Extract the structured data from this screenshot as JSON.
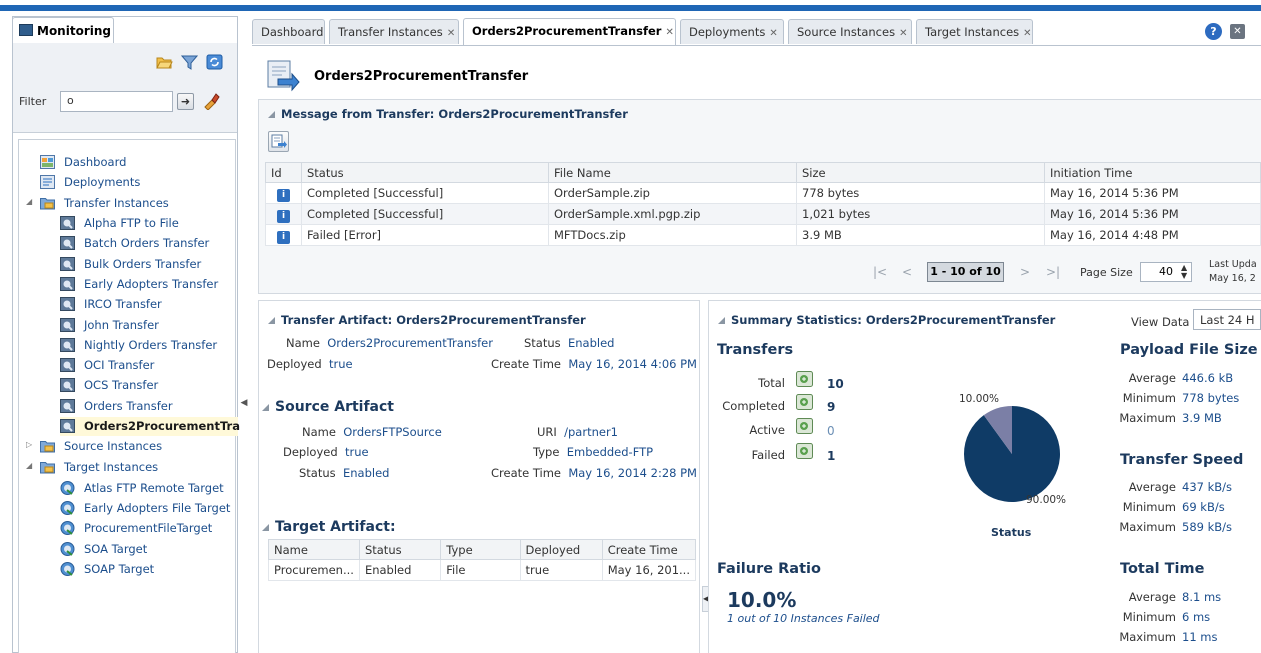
{
  "left": {
    "tab_label": "Monitoring",
    "filter_label": "Filter",
    "filter_value": "o",
    "go_label": "➜",
    "tree": [
      {
        "label": "Dashboard",
        "icon": "dashboard-icon"
      },
      {
        "label": "Deployments",
        "icon": "deployments-icon"
      },
      {
        "label": "Transfer Instances",
        "icon": "folder-icon"
      },
      {
        "label": "Alpha FTP to File",
        "icon": "transfer-icon"
      },
      {
        "label": "Batch Orders Transfer",
        "icon": "transfer-icon"
      },
      {
        "label": "Bulk Orders Transfer",
        "icon": "transfer-icon"
      },
      {
        "label": "Early Adopters Transfer",
        "icon": "transfer-icon"
      },
      {
        "label": "IRCO Transfer",
        "icon": "transfer-icon"
      },
      {
        "label": "John Transfer",
        "icon": "transfer-icon"
      },
      {
        "label": "Nightly Orders Transfer",
        "icon": "transfer-icon"
      },
      {
        "label": "OCI Transfer",
        "icon": "transfer-icon"
      },
      {
        "label": "OCS Transfer",
        "icon": "transfer-icon"
      },
      {
        "label": "Orders Transfer",
        "icon": "transfer-icon"
      },
      {
        "label": "Orders2ProcurementTra",
        "icon": "transfer-icon"
      },
      {
        "label": "Source Instances",
        "icon": "folder-icon"
      },
      {
        "label": "Target Instances",
        "icon": "folder-icon"
      },
      {
        "label": "Atlas FTP Remote Target",
        "icon": "target-icon"
      },
      {
        "label": "Early Adopters File Target",
        "icon": "target-icon"
      },
      {
        "label": "ProcurementFileTarget",
        "icon": "target-icon"
      },
      {
        "label": "SOA Target",
        "icon": "target-icon"
      },
      {
        "label": "SOAP Target",
        "icon": "target-icon"
      }
    ]
  },
  "tabs": [
    {
      "label": "Dashboard",
      "closable": false
    },
    {
      "label": "Transfer Instances",
      "closable": true
    },
    {
      "label": "Orders2ProcurementTransfer",
      "closable": true
    },
    {
      "label": "Deployments",
      "closable": true
    },
    {
      "label": "Source Instances",
      "closable": true
    },
    {
      "label": "Target Instances",
      "closable": true
    }
  ],
  "close_glyph": "✕",
  "page_title": "Orders2ProcurementTransfer",
  "message_section": {
    "title": "Message from Transfer: Orders2ProcurementTransfer",
    "columns": [
      "Id",
      "Status",
      "File Name",
      "Size",
      "Initiation Time"
    ],
    "rows": [
      {
        "status": "Completed [Successful]",
        "file": "OrderSample.zip",
        "size": "778 bytes",
        "time": "May 16, 2014 5:36 PM"
      },
      {
        "status": "Completed [Successful]",
        "file": "OrderSample.xml.pgp.zip",
        "size": "1,021 bytes",
        "time": "May 16, 2014 5:36 PM"
      },
      {
        "status": "Failed [Error]",
        "file": "MFTDocs.zip",
        "size": "3.9 MB",
        "time": "May 16, 2014 4:48 PM"
      }
    ],
    "info_glyph": "i",
    "pager": {
      "range": "1 - 10 of 10",
      "page_size_label": "Page Size",
      "page_size": "40",
      "last_updated_label": "Last Upda",
      "last_updated_value": "May 16, 2"
    }
  },
  "artifact": {
    "title": "Transfer Artifact: Orders2ProcurementTransfer",
    "name_label": "Name",
    "name_value": "Orders2ProcurementTransfer",
    "status_label": "Status",
    "status_value": "Enabled",
    "deployed_label": "Deployed",
    "deployed_value": "true",
    "create_label": "Create Time",
    "create_value": "May 16, 2014 4:06 PM",
    "source": {
      "title": "Source Artifact",
      "name_label": "Name",
      "name_value": "OrdersFTPSource",
      "uri_label": "URI",
      "uri_value": "/partner1",
      "deployed_label": "Deployed",
      "deployed_value": "true",
      "type_label": "Type",
      "type_value": "Embedded-FTP",
      "status_label": "Status",
      "status_value": "Enabled",
      "create_label": "Create Time",
      "create_value": "May 16, 2014 2:28 PM"
    },
    "target": {
      "title": "Target Artifact:",
      "columns": [
        "Name",
        "Status",
        "Type",
        "Deployed",
        "Create Time"
      ],
      "row": [
        "Procuremen...",
        "Enabled",
        "File",
        "true",
        "May 16, 201..."
      ]
    }
  },
  "summary": {
    "title": "Summary Statistics: Orders2ProcurementTransfer",
    "view_data_label": "View Data",
    "view_data_value": "Last 24 H",
    "transfers_title": "Transfers",
    "counts": [
      {
        "label": "Total",
        "value": "10"
      },
      {
        "label": "Completed",
        "value": "9"
      },
      {
        "label": "Active",
        "value": "0"
      },
      {
        "label": "Failed",
        "value": "1"
      }
    ],
    "pie": {
      "failed_pct_label": "10.00%",
      "completed_pct_label": "90.00%",
      "caption": "Status",
      "failed_fraction": 0.1,
      "color_completed": "#0f3b66",
      "color_failed": "#7b7fa6"
    },
    "failure_title": "Failure Ratio",
    "failure_value": "10.0%",
    "failure_sub": "1 out of 10 Instances Failed",
    "payload_title": "Payload File Size",
    "payload": [
      {
        "label": "Average",
        "value": "446.6 kB"
      },
      {
        "label": "Minimum",
        "value": "778 bytes"
      },
      {
        "label": "Maximum",
        "value": "3.9 MB"
      }
    ],
    "speed_title": "Transfer Speed",
    "speed": [
      {
        "label": "Average",
        "value": "437 kB/s"
      },
      {
        "label": "Minimum",
        "value": "69 kB/s"
      },
      {
        "label": "Maximum",
        "value": "589 kB/s"
      }
    ],
    "time_title": "Total Time",
    "time": [
      {
        "label": "Average",
        "value": "8.1 ms"
      },
      {
        "label": "Minimum",
        "value": "6 ms"
      },
      {
        "label": "Maximum",
        "value": "11 ms"
      }
    ]
  },
  "colors": {
    "accent": "#1f66b5",
    "heading": "#1c3a5e",
    "link": "#1c4e8c"
  }
}
